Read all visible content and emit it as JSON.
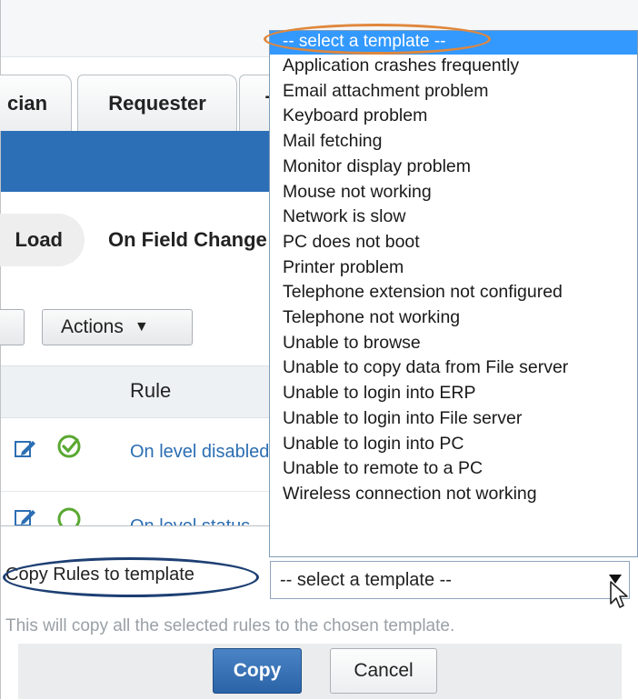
{
  "tabs": [
    {
      "label": "cian"
    },
    {
      "label": "Requester"
    },
    {
      "label": "T"
    }
  ],
  "form_rule_triggers": {
    "load_label": "Load",
    "field_change_label": "On Field Change"
  },
  "toolbar": {
    "actions_label": "Actions",
    "actions_caret": "▼"
  },
  "table": {
    "rule_header": "Rule",
    "rows": [
      {
        "rule_link": "On level disabled"
      },
      {
        "rule_link": "On level status"
      }
    ]
  },
  "copy_section": {
    "label": "Copy Rules to template",
    "select_value": "-- select a template --",
    "helper_text": "This will copy all the selected rules to the chosen template.",
    "copy_button": "Copy",
    "cancel_button": "Cancel"
  },
  "dropdown": {
    "selected": "-- select a template --",
    "options": [
      "Application crashes frequently",
      "Email attachment problem",
      "Keyboard problem",
      "Mail fetching",
      "Monitor display problem",
      "Mouse not working",
      "Network is slow",
      "PC does not boot",
      "Printer problem",
      "Telephone extension not configured",
      "Telephone not working",
      "Unable to browse",
      "Unable to copy data from File server",
      "Unable to login into ERP",
      "Unable to login into File server",
      "Unable to login into PC",
      "Unable to remote to a PC",
      "Wireless connection not working"
    ]
  },
  "icons": {
    "edit": "edit-icon",
    "status": "check-circle-icon",
    "select_arrow": "caret-down-icon",
    "cursor": "mouse-pointer-icon"
  },
  "colors": {
    "accent_blue": "#2d6fb7",
    "link_blue": "#2c6eb3",
    "highlight_oval_orange": "#e0873c",
    "highlight_oval_navy": "#1d3f73",
    "status_green": "#5aa832",
    "selection_blue": "#3399ff"
  }
}
